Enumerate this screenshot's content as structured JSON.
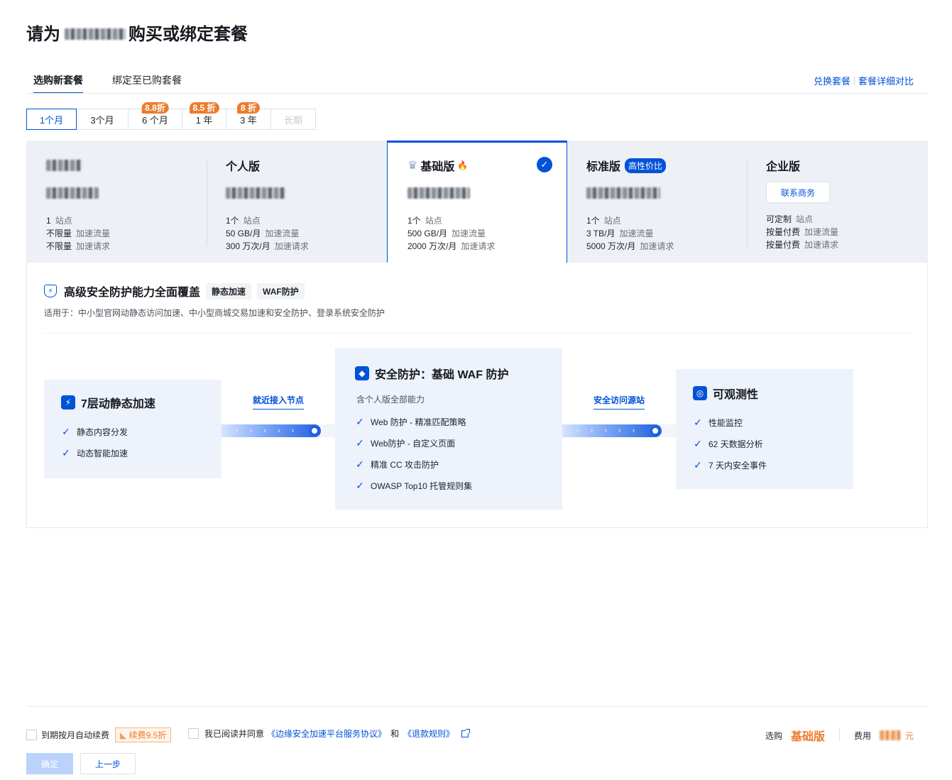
{
  "header": {
    "title_prefix": "请为",
    "title_suffix": "购买或绑定套餐"
  },
  "tabs": [
    {
      "label": "选购新套餐"
    },
    {
      "label": "绑定至已购套餐"
    }
  ],
  "top_links": {
    "exchange": "兑换套餐",
    "compare": "套餐详细对比"
  },
  "periods": [
    {
      "label": "1个月",
      "badge": ""
    },
    {
      "label": "3个月",
      "badge": ""
    },
    {
      "label": "6 个月",
      "badge": "8.8折"
    },
    {
      "label": "1 年",
      "badge": "8.5 折"
    },
    {
      "label": "3 年",
      "badge": "8 折"
    },
    {
      "label": "长期",
      "badge": ""
    }
  ],
  "plans": [
    {
      "name": "",
      "specs": [
        {
          "v": "1",
          "k": "站点"
        },
        {
          "v": "不限量",
          "k": "加速流量"
        },
        {
          "v": "不限量",
          "k": "加速请求"
        }
      ]
    },
    {
      "name": "个人版",
      "specs": [
        {
          "v": "1个",
          "k": "站点"
        },
        {
          "v": "50 GB/月",
          "k": "加速流量"
        },
        {
          "v": "300 万次/月",
          "k": "加速请求"
        }
      ]
    },
    {
      "name": "基础版",
      "specs": [
        {
          "v": "1个",
          "k": "站点"
        },
        {
          "v": "500 GB/月",
          "k": "加速流量"
        },
        {
          "v": "2000 万次/月",
          "k": "加速请求"
        }
      ]
    },
    {
      "name": "标准版",
      "tag": "高性价比",
      "specs": [
        {
          "v": "1个",
          "k": "站点"
        },
        {
          "v": "3 TB/月",
          "k": "加速流量"
        },
        {
          "v": "5000 万次/月",
          "k": "加速请求"
        }
      ]
    },
    {
      "name": "企业版",
      "contact": "联系商务",
      "specs": [
        {
          "v": "可定制",
          "k": "站点"
        },
        {
          "v": "按量付费",
          "k": "加速流量"
        },
        {
          "v": "按量付费",
          "k": "加速请求"
        }
      ]
    }
  ],
  "detail": {
    "title": "高级安全防护能力全面覆盖",
    "chips": [
      "静态加速",
      "WAF防护"
    ],
    "desc": "适用于：中小型官网动静态访问加速、中小型商城交易加速和安全防护、登录系统安全防护",
    "accel": {
      "title": "7层动静态加速",
      "items": [
        "静态内容分发",
        "动态智能加速"
      ]
    },
    "flow1": "就近接入节点",
    "security": {
      "title": "安全防护：基础 WAF 防护",
      "sub": "含个人版全部能力",
      "items": [
        "Web 防护 - 精准匹配策略",
        "Web防护 - 自定义页面",
        "精准 CC 攻击防护",
        "OWASP Top10 托管规则集"
      ]
    },
    "flow2": "安全访问源站",
    "observe": {
      "title": "可观测性",
      "items": [
        "性能监控",
        "62 天数据分析",
        "7 天内安全事件"
      ]
    }
  },
  "footer": {
    "auto_renew": "到期按月自动续费",
    "renew_tag": "续费9.5折",
    "agree_prefix": "我已阅读并同意",
    "agreement": "《边缘安全加速平台服务协议》",
    "and": "和",
    "refund": "《退款规则》",
    "selected_label": "选购",
    "selected_plan": "基础版",
    "cost_label": "费用",
    "cost_unit": "元",
    "confirm": "确定",
    "prev": "上一步"
  },
  "colors": {
    "primary": "#0052d9",
    "accent": "#ed7b2f",
    "plan_bg": "#edf0f5"
  }
}
